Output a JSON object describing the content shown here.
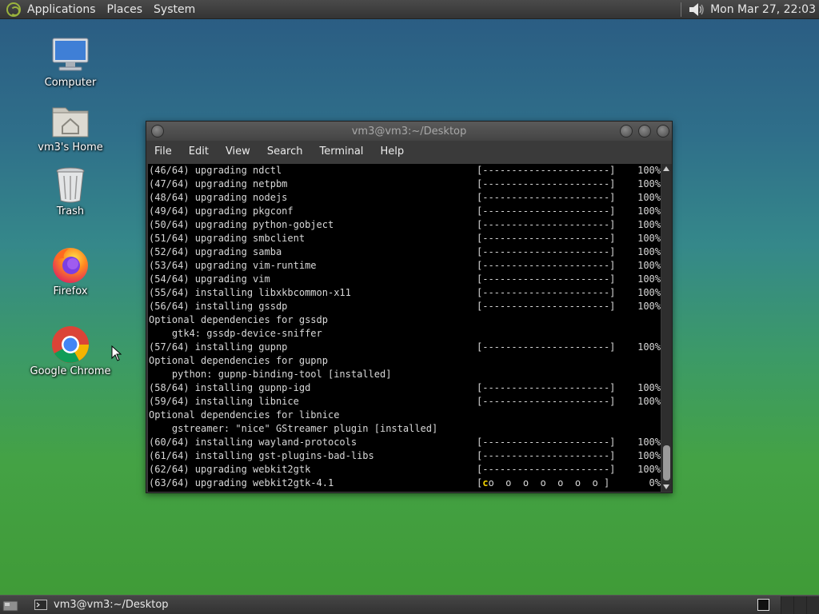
{
  "top_panel": {
    "menus": [
      "Applications",
      "Places",
      "System"
    ],
    "clock": "Mon Mar 27, 22:03"
  },
  "desktop_icons": [
    {
      "label": "Computer",
      "icon": "computer-icon"
    },
    {
      "label": "vm3's Home",
      "icon": "home-folder-icon"
    },
    {
      "label": "Trash",
      "icon": "trash-icon"
    },
    {
      "label": "Firefox",
      "icon": "firefox-icon"
    },
    {
      "label": "Google Chrome",
      "icon": "chrome-icon"
    }
  ],
  "terminal": {
    "title": "vm3@vm3:~/Desktop",
    "menu": [
      "File",
      "Edit",
      "View",
      "Search",
      "Terminal",
      "Help"
    ],
    "lines": [
      {
        "left": "(46/64) upgrading ndctl",
        "bar": "[----------------------]",
        "pct": "100%"
      },
      {
        "left": "(47/64) upgrading netpbm",
        "bar": "[----------------------]",
        "pct": "100%"
      },
      {
        "left": "(48/64) upgrading nodejs",
        "bar": "[----------------------]",
        "pct": "100%"
      },
      {
        "left": "(49/64) upgrading pkgconf",
        "bar": "[----------------------]",
        "pct": "100%"
      },
      {
        "left": "(50/64) upgrading python-gobject",
        "bar": "[----------------------]",
        "pct": "100%"
      },
      {
        "left": "(51/64) upgrading smbclient",
        "bar": "[----------------------]",
        "pct": "100%"
      },
      {
        "left": "(52/64) upgrading samba",
        "bar": "[----------------------]",
        "pct": "100%"
      },
      {
        "left": "(53/64) upgrading vim-runtime",
        "bar": "[----------------------]",
        "pct": "100%"
      },
      {
        "left": "(54/64) upgrading vim",
        "bar": "[----------------------]",
        "pct": "100%"
      },
      {
        "left": "(55/64) installing libxkbcommon-x11",
        "bar": "[----------------------]",
        "pct": "100%"
      },
      {
        "left": "(56/64) installing gssdp",
        "bar": "[----------------------]",
        "pct": "100%"
      },
      {
        "left": "Optional dependencies for gssdp",
        "bar": "",
        "pct": ""
      },
      {
        "left": "    gtk4: gssdp-device-sniffer",
        "bar": "",
        "pct": ""
      },
      {
        "left": "(57/64) installing gupnp",
        "bar": "[----------------------]",
        "pct": "100%"
      },
      {
        "left": "Optional dependencies for gupnp",
        "bar": "",
        "pct": ""
      },
      {
        "left": "    python: gupnp-binding-tool [installed]",
        "bar": "",
        "pct": ""
      },
      {
        "left": "(58/64) installing gupnp-igd",
        "bar": "[----------------------]",
        "pct": "100%"
      },
      {
        "left": "(59/64) installing libnice",
        "bar": "[----------------------]",
        "pct": "100%"
      },
      {
        "left": "Optional dependencies for libnice",
        "bar": "",
        "pct": ""
      },
      {
        "left": "    gstreamer: \"nice\" GStreamer plugin [installed]",
        "bar": "",
        "pct": ""
      },
      {
        "left": "(60/64) installing wayland-protocols",
        "bar": "[----------------------]",
        "pct": "100%"
      },
      {
        "left": "(61/64) installing gst-plugins-bad-libs",
        "bar": "[----------------------]",
        "pct": "100%"
      },
      {
        "left": "(62/64) upgrading webkit2gtk",
        "bar": "[----------------------]",
        "pct": "100%"
      },
      {
        "left": "(63/64) upgrading webkit2gtk-4.1",
        "bar": "[co  o  o  o  o  o  o ]",
        "pct": "0%"
      }
    ]
  },
  "taskbar": {
    "task_label": "vm3@vm3:~/Desktop"
  },
  "colors": {
    "pacman": "#f0d000",
    "terminal_bg": "#000000",
    "panel_bg": "#3c3c3c"
  }
}
